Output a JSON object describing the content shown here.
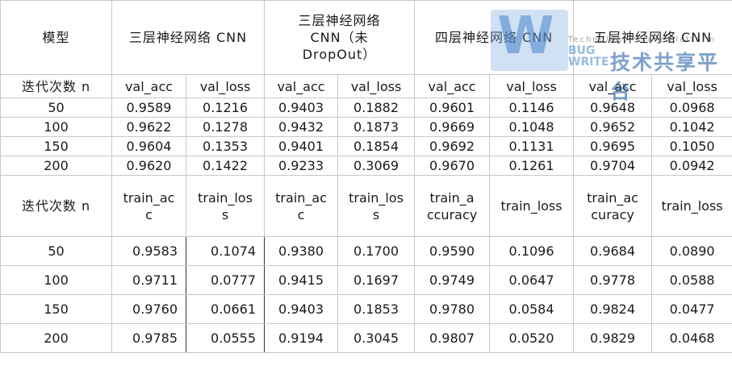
{
  "header": {
    "model_label": "模型",
    "models": [
      "三层神经网络 CNN",
      "三层神经网络\nCNN（未\nDropOut）",
      "四层神经网络 CNN",
      "五层神经网络 CNN"
    ]
  },
  "val_section": {
    "row_label": "迭代次数 n",
    "columns": [
      "val_acc",
      "val_loss",
      "val_acc",
      "val_loss",
      "val_acc",
      "val_loss",
      "val_acc",
      "val_loss"
    ],
    "rows": [
      {
        "n": "50",
        "values": [
          "0.9589",
          "0.1216",
          "0.9403",
          "0.1882",
          "0.9601",
          "0.1146",
          "0.9648",
          "0.0968"
        ]
      },
      {
        "n": "100",
        "values": [
          "0.9622",
          "0.1278",
          "0.9432",
          "0.1873",
          "0.9669",
          "0.1048",
          "0.9652",
          "0.1042"
        ]
      },
      {
        "n": "150",
        "values": [
          "0.9604",
          "0.1353",
          "0.9401",
          "0.1854",
          "0.9692",
          "0.1131",
          "0.9695",
          "0.1050"
        ]
      },
      {
        "n": "200",
        "values": [
          "0.9620",
          "0.1422",
          "0.9233",
          "0.3069",
          "0.9670",
          "0.1261",
          "0.9704",
          "0.0942"
        ]
      }
    ]
  },
  "train_section": {
    "row_label": "迭代次数 n",
    "columns": [
      "train_ac\nc",
      "train_los\ns",
      "train_ac\nc",
      "train_los\ns",
      "train_a\nccuracy",
      "train_loss",
      "train_ac\ncuracy",
      "train_loss"
    ],
    "rows": [
      {
        "n": "50",
        "values": [
          "0.9583",
          "0.1074",
          "0.9380",
          "0.1700",
          "0.9590",
          "0.1096",
          "0.9684",
          "0.0890"
        ]
      },
      {
        "n": "100",
        "values": [
          "0.9711",
          "0.0777",
          "0.9415",
          "0.1697",
          "0.9749",
          "0.0647",
          "0.9778",
          "0.0588"
        ]
      },
      {
        "n": "150",
        "values": [
          "0.9760",
          "0.0661",
          "0.9403",
          "0.1853",
          "0.9780",
          "0.0584",
          "0.9824",
          "0.0477"
        ]
      },
      {
        "n": "200",
        "values": [
          "0.9785",
          "0.0555",
          "0.9194",
          "0.3045",
          "0.9807",
          "0.0520",
          "0.9829",
          "0.0468"
        ]
      }
    ]
  },
  "watermark": {
    "logo": "W",
    "small_text": "Technology Share Platform",
    "bug_line1": "BUG",
    "bug_line2": "WRITE",
    "cn_text": "技术共享平台"
  }
}
